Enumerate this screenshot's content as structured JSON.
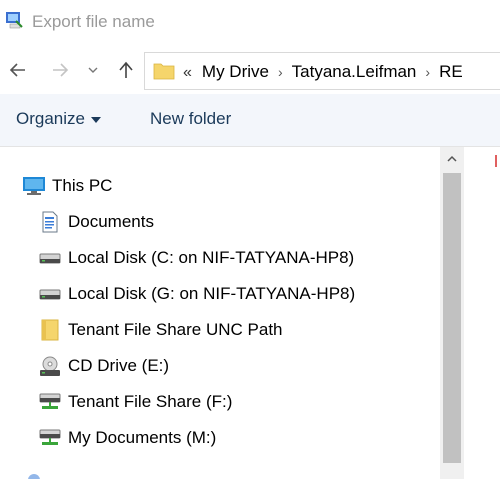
{
  "window": {
    "title": "Export file name"
  },
  "nav": {
    "back": "back-arrow-icon",
    "forward": "forward-arrow-icon",
    "recent": "chevron-down-icon",
    "up": "up-arrow-icon"
  },
  "address": {
    "overflow": "«",
    "crumbs": [
      "My Drive",
      "Tatyana.Leifman",
      "RE"
    ]
  },
  "toolbar": {
    "organize_label": "Organize",
    "new_folder_label": "New folder"
  },
  "tree": {
    "root": "This PC",
    "items": [
      {
        "label": "Documents",
        "icon": "document-icon"
      },
      {
        "label": "Local Disk (C: on NIF-TATYANA-HP8)",
        "icon": "drive-icon"
      },
      {
        "label": "Local Disk (G: on NIF-TATYANA-HP8)",
        "icon": "drive-icon"
      },
      {
        "label": "Tenant File Share UNC Path",
        "icon": "folder-icon"
      },
      {
        "label": "CD Drive (E:)",
        "icon": "cd-drive-icon"
      },
      {
        "label": "Tenant File Share (F:)",
        "icon": "network-drive-icon"
      },
      {
        "label": "My Documents (M:)",
        "icon": "network-drive-icon"
      }
    ]
  },
  "colors": {
    "toolbar_bg": "#f3f6fb",
    "toolbar_text": "#1b3a5a",
    "folder": "#f5d56b",
    "scroll_thumb": "#c1c1c1"
  }
}
